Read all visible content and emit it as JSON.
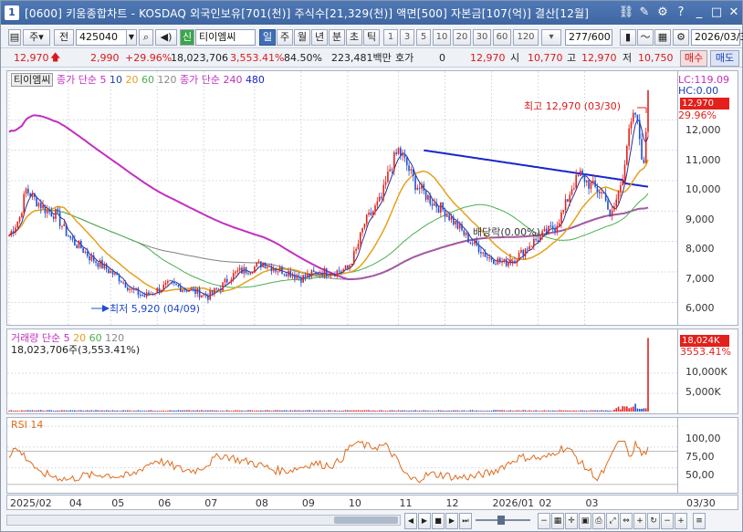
{
  "window": {
    "number": "1",
    "title": "[0600] 키움종합차트 - KOSDAQ 외국인보유[701(천)] 주식수[21,329(천)] 액면[500] 자본금[107(억)] 결산[12월]"
  },
  "toolbar": {
    "market": "주",
    "period_type": "전",
    "code": "425040",
    "stock_name": "티이엠씨",
    "stock_badge": "신",
    "periods": [
      "일",
      "주",
      "월",
      "년",
      "분",
      "초",
      "틱"
    ],
    "minutes": [
      "1",
      "3",
      "5",
      "10",
      "20",
      "30",
      "60",
      "120"
    ],
    "count": "277/600",
    "date": "2026/03/3"
  },
  "quote": {
    "price": "12,970",
    "change": "2,990",
    "change_pct": "+29.96%",
    "volume": "18,023,706",
    "vol_pct": "3,553.41%",
    "turnover": "84.50%",
    "amount": "223,481백만",
    "hoga_label": "호가",
    "hoga_val": "0",
    "ask": "12,970",
    "open_label": "시",
    "open": "10,770",
    "high_label": "고",
    "high": "12,970",
    "low_label": "저",
    "low": "10,750",
    "buy_label": "매수",
    "sell_label": "매도"
  },
  "price_pane": {
    "name": "티이엠씨",
    "ma_label": "종가 단순 5",
    "ma_periods": [
      "10",
      "20",
      "60",
      "120"
    ],
    "ma2_label": "종가 단순 240",
    "ma2_period": "480",
    "lc": "LC:119.09",
    "hc": "HC:0.00",
    "last_price_tag": "12,970",
    "last_pct": "29.96%",
    "high_note": "최고 12,970 (03/30)",
    "low_note": "최저 5,920 (04/09)",
    "dividend_note": "배당락(0.00%)",
    "y_ticks": [
      "12,000",
      "11,000",
      "10,000",
      "9,000",
      "8,000",
      "7,000",
      "6,000"
    ]
  },
  "volume_pane": {
    "label": "거래량",
    "ma_label": "단순 5",
    "ma_periods": [
      "20",
      "60",
      "120"
    ],
    "value_text": "18,023,706주(3,553.41%)",
    "tag": "18,024K",
    "tag_pct": "3553.41%",
    "y_ticks": [
      "10,000K",
      "5,000K"
    ]
  },
  "rsi_pane": {
    "label": "RSI 14",
    "y_ticks": [
      "100,00",
      "75,00",
      "50,00"
    ]
  },
  "x_axis": {
    "labels": [
      "2025/02",
      "04",
      "05",
      "06",
      "07",
      "08",
      "09",
      "10",
      "11",
      "12",
      "2026/01",
      "02",
      "03"
    ],
    "right_label": "03/30"
  },
  "colors": {
    "up": "#e3201b",
    "down": "#1e4fd1",
    "ma5": "#2a2f8f",
    "ma20": "#e6a11c",
    "ma60": "#4caf4f",
    "ma120": "#808080",
    "ma240": "#c22fbf",
    "ma480": "#1726c9",
    "rsi": "#e06a1c"
  },
  "chart_data": {
    "type": "candlestick",
    "points": [
      [
        0,
        8200
      ],
      [
        5,
        8800
      ],
      [
        8,
        9700
      ],
      [
        12,
        9400
      ],
      [
        18,
        9000
      ],
      [
        22,
        8900
      ],
      [
        26,
        8400
      ],
      [
        30,
        8000
      ],
      [
        34,
        7800
      ],
      [
        38,
        7500
      ],
      [
        42,
        7300
      ],
      [
        46,
        7100
      ],
      [
        52,
        6800
      ],
      [
        58,
        6400
      ],
      [
        64,
        6200
      ],
      [
        70,
        6400
      ],
      [
        76,
        6600
      ],
      [
        80,
        6500
      ],
      [
        86,
        6400
      ],
      [
        90,
        6300
      ],
      [
        94,
        6200
      ],
      [
        100,
        6500
      ],
      [
        104,
        6800
      ],
      [
        108,
        7000
      ],
      [
        114,
        7100
      ],
      [
        120,
        7300
      ],
      [
        126,
        7100
      ],
      [
        132,
        7000
      ],
      [
        138,
        6800
      ],
      [
        142,
        6900
      ],
      [
        148,
        7000
      ],
      [
        154,
        7000
      ],
      [
        160,
        7100
      ],
      [
        164,
        7700
      ],
      [
        168,
        8600
      ],
      [
        172,
        9000
      ],
      [
        176,
        9400
      ],
      [
        180,
        10400
      ],
      [
        184,
        11000
      ],
      [
        188,
        10500
      ],
      [
        192,
        9900
      ],
      [
        196,
        9600
      ],
      [
        200,
        9300
      ],
      [
        206,
        9000
      ],
      [
        212,
        8500
      ],
      [
        218,
        8000
      ],
      [
        222,
        7800
      ],
      [
        226,
        7500
      ],
      [
        230,
        7400
      ],
      [
        234,
        7300
      ],
      [
        238,
        7400
      ],
      [
        242,
        7600
      ],
      [
        246,
        7900
      ],
      [
        252,
        8200
      ],
      [
        258,
        8500
      ],
      [
        262,
        9000
      ],
      [
        266,
        9800
      ],
      [
        270,
        10200
      ],
      [
        274,
        9900
      ],
      [
        278,
        9700
      ],
      [
        282,
        9500
      ],
      [
        284,
        8700
      ],
      [
        288,
        9600
      ],
      [
        290,
        10200
      ],
      [
        292,
        11200
      ],
      [
        294,
        11800
      ],
      [
        296,
        12200
      ],
      [
        298,
        11400
      ],
      [
        300,
        10400
      ],
      [
        302,
        12970
      ]
    ],
    "ylim": [
      5500,
      13000
    ]
  }
}
